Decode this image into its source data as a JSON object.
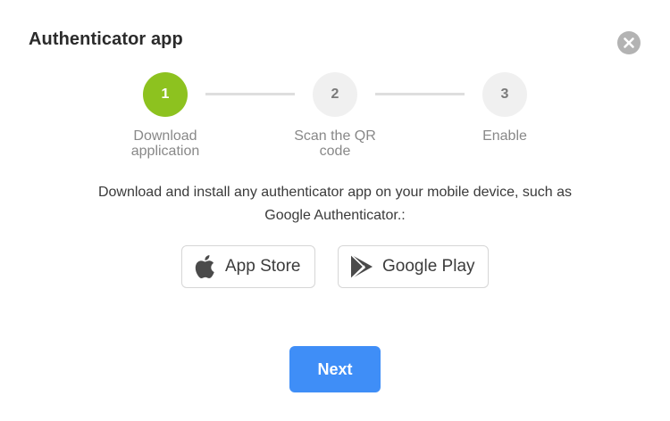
{
  "dialog": {
    "title": "Authenticator app",
    "close_icon": "close-icon"
  },
  "stepper": {
    "steps": [
      {
        "number": "1",
        "label_line1": "Download",
        "label_line2": "application",
        "active": true
      },
      {
        "number": "2",
        "label_line1": "Scan the QR",
        "label_line2": "code",
        "active": false
      },
      {
        "number": "3",
        "label_line1": "Enable",
        "label_line2": "",
        "active": false
      }
    ],
    "active_color": "#8dc21f",
    "inactive_color": "#f0f0f0"
  },
  "description": {
    "line1": "Download and install any authenticator app on your mobile device, such as",
    "line2": "Google Authenticator.:"
  },
  "stores": {
    "app_store": {
      "label": "App Store",
      "icon": "apple-icon"
    },
    "google_play": {
      "label": "Google Play",
      "icon": "google-play-icon"
    }
  },
  "actions": {
    "next_label": "Next",
    "next_color": "#3f8ef7"
  }
}
